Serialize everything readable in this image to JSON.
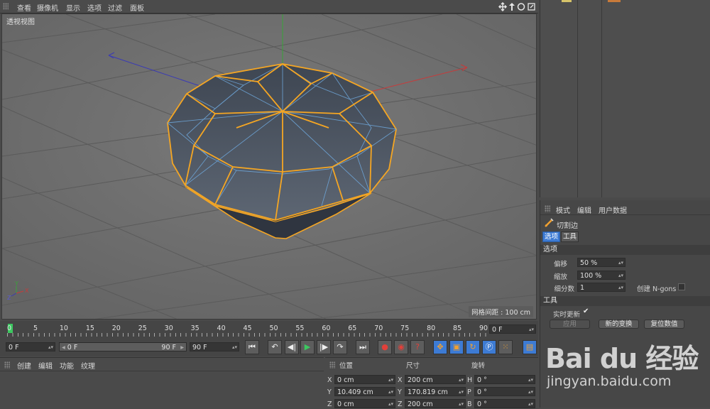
{
  "menubar": {
    "items": [
      "查看",
      "摄像机",
      "显示",
      "选项",
      "过滤",
      "面板"
    ]
  },
  "viewport": {
    "label": "透视视图",
    "grid_info": "网格间距 : 100 cm"
  },
  "attributes": {
    "tabs": [
      "模式",
      "编辑",
      "用户数据"
    ],
    "tool_name": "切割边",
    "subtabs": [
      "选项",
      "工具"
    ],
    "options_header": "选项",
    "fields": [
      {
        "label": "偏移",
        "value": "50 %"
      },
      {
        "label": "缩放",
        "value": "100 %"
      },
      {
        "label": "细分数",
        "value": "1"
      }
    ],
    "ngons_label": "创建 N-gons",
    "tools_header": "工具",
    "realtime_label": "实时更新",
    "realtime_check": "✔",
    "buttons": [
      "应用",
      "新的变换",
      "复位数值"
    ]
  },
  "timeline": {
    "ticks": [
      "0",
      "5",
      "10",
      "15",
      "20",
      "25",
      "30",
      "35",
      "40",
      "45",
      "50",
      "55",
      "60",
      "65",
      "70",
      "75",
      "80",
      "85",
      "90"
    ],
    "current_frame": "0 F"
  },
  "transport": {
    "start": "0 F",
    "range_start": "0 F",
    "range_end": "90 F",
    "end": "90 F"
  },
  "bottom_menu": {
    "items": [
      "创建",
      "编辑",
      "功能",
      "纹理"
    ]
  },
  "coords": {
    "headers": [
      "位置",
      "尺寸",
      "旋转"
    ],
    "rows": [
      {
        "pos_axis": "X",
        "pos": "0 cm",
        "size_axis": "X",
        "size": "200 cm",
        "rot_axis": "H",
        "rot": "0 °"
      },
      {
        "pos_axis": "Y",
        "pos": "10.409 cm",
        "size_axis": "Y",
        "size": "170.819 cm",
        "rot_axis": "P",
        "rot": "0 °"
      },
      {
        "pos_axis": "Z",
        "pos": "0 cm",
        "size_axis": "Z",
        "size": "200 cm",
        "rot_axis": "B",
        "rot": "0 °"
      }
    ]
  },
  "watermark": {
    "brand": "Bai du 经验",
    "url": "jingyan.baidu.com"
  },
  "colors": {
    "accent": "#f5a623",
    "wire": "#6fa8dc",
    "highlight": "#3d7bd4"
  }
}
